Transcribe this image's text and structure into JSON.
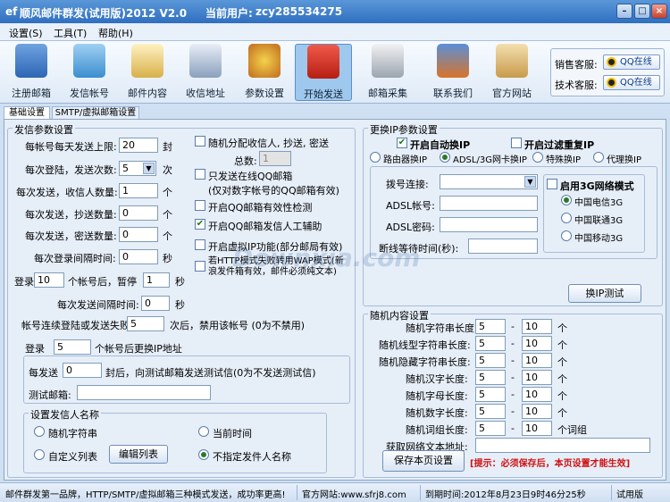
{
  "window": {
    "title": "顺风邮件群发(试用版)2012 V2.0",
    "user_prefix": "当前用户:",
    "user": "zcy285534275"
  },
  "menu": [
    "设置(S)",
    "工具(T)",
    "帮助(H)"
  ],
  "toolbar": [
    "注册邮箱",
    "发信帐号",
    "邮件内容",
    "收信地址",
    "参数设置",
    "开始发送",
    "邮箱采集",
    "联系我们",
    "官方网站"
  ],
  "service": {
    "sales_label": "销售客服:",
    "tech_label": "技术客服:",
    "qq_label": "QQ在线"
  },
  "tabs": [
    "基础设置",
    "SMTP/虚拟邮箱设置"
  ],
  "send_params": {
    "title": "发信参数设置",
    "per_account_limit_label": "每帐号每天发送上限:",
    "per_account_limit": "20",
    "unit_feng": "封",
    "login_times_label": "每次登陆，发送次数:",
    "login_times": "5",
    "unit_ci": "次",
    "recipients_label": "每次发送，收信人数量:",
    "recipients": "1",
    "unit_ge": "个",
    "cc_label": "每次发送，抄送数量:",
    "cc": "0",
    "bcc_label": "每次发送，密送数量:",
    "bcc": "0",
    "login_interval_label": "每次登录间隔时间:",
    "login_interval": "0",
    "unit_sec": "秒",
    "pause_pre": "登录",
    "pause_count": "10",
    "pause_mid": "个帐号后，暂停",
    "pause_sec": "1",
    "send_interval_label": "每次发送间隔时间:",
    "send_interval": "0",
    "fail_label": "帐号连续登陆或发送失败",
    "fail_count": "5",
    "fail_suffix": "次后，禁用该帐号 (0为不禁用)",
    "change_ip_pre": "登录",
    "change_ip_count": "5",
    "change_ip_suffix": "个帐号后更换IP地址",
    "test_pre": "每发送",
    "test_count": "0",
    "test_suffix": "封后，向测试邮箱发送测试信(0为不发送测试信)",
    "test_mail_label": "测试邮箱:",
    "test_mail": ""
  },
  "options": {
    "random_cc": "随机分配收信人, 抄送, 密送",
    "total_label": "总数:",
    "total": "1",
    "qq_only": "只发送在线QQ邮箱",
    "qq_only_note": "(仅对数字帐号的QQ邮箱有效)",
    "qq_check": "开启QQ邮箱有效性检测",
    "qq_assist": "开启QQ邮箱发信人工辅助",
    "virtual_ip": "开启虚拟IP功能(部分邮局有效)",
    "http_fallback": "若HTTP模式失败转用WAP模式(新浪发件箱有效，邮件必须纯文本)"
  },
  "sender_name": {
    "title": "设置发信人名称",
    "random": "随机字符串",
    "current_time": "当前时间",
    "custom_list": "自定义列表",
    "edit_list": "编辑列表",
    "unspecified": "不指定发件人名称"
  },
  "ip_params": {
    "title": "更换IP参数设置",
    "auto_ip": "开启自动换IP",
    "filter_dup": "开启过滤重复IP",
    "router": "路由器换IP",
    "adsl": "ADSL/3G网卡换IP",
    "special": "特殊换IP",
    "proxy": "代理换IP",
    "dial_label": "拨号连接:",
    "dial": "",
    "adsl_user_label": "ADSL帐号:",
    "adsl_user": "",
    "adsl_pwd_label": "ADSL密码:",
    "adsl_pwd": "",
    "wait_label": "断线等待时间(秒):",
    "wait": "",
    "net3g": "启用3G网络模式",
    "telecom": "中国电信3G",
    "unicom": "中国联通3G",
    "mobile": "中国移动3G",
    "test_btn": "换IP测试"
  },
  "random_content": {
    "title": "随机内容设置",
    "dash": "-",
    "unit": "个",
    "unit_phrase": "个词组",
    "rows": [
      {
        "label": "随机字符串长度:",
        "min": "5",
        "max": "10"
      },
      {
        "label": "随机线型字符串长度:",
        "min": "5",
        "max": "10"
      },
      {
        "label": "随机隐藏字符串长度:",
        "min": "5",
        "max": "10"
      },
      {
        "label": "随机汉字长度:",
        "min": "5",
        "max": "10"
      },
      {
        "label": "随机字母长度:",
        "min": "5",
        "max": "10"
      },
      {
        "label": "随机数字长度:",
        "min": "5",
        "max": "10"
      },
      {
        "label": "随机词组长度:",
        "min": "5",
        "max": "10"
      }
    ],
    "fetch_label": "获取网络文本地址:",
    "fetch": "",
    "save_btn": "保存本页设置",
    "hint": "[提示：必须保存后，本页设置才能生效]"
  },
  "status": {
    "slogan": "邮件群发第一品牌，HTTP/SMTP/虚拟邮箱三种模式发送，成功率更高!",
    "site": "官方网站:www.sfrj8.com",
    "expire": "到期时间:2012年8月23日9时46分25秒",
    "mode": "试用版"
  },
  "watermark": "Downxia.com"
}
